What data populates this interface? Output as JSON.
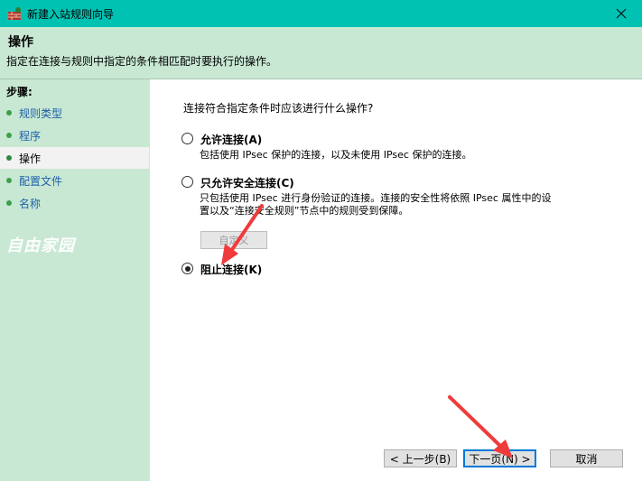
{
  "window": {
    "title": "新建入站规则向导",
    "close_glyph": "✕"
  },
  "header": {
    "title": "操作",
    "subtitle": "指定在连接与规则中指定的条件相匹配时要执行的操作。"
  },
  "nav": {
    "title": "步骤:",
    "items": [
      {
        "label": "规则类型",
        "selected": false
      },
      {
        "label": "程序",
        "selected": false
      },
      {
        "label": "操作",
        "selected": true
      },
      {
        "label": "配置文件",
        "selected": false
      },
      {
        "label": "名称",
        "selected": false
      }
    ],
    "watermark": "自由家园"
  },
  "main": {
    "question": "连接符合指定条件时应该进行什么操作?",
    "options": [
      {
        "label": "允许连接(A)",
        "desc": [
          "包括使用 IPsec 保护的连接，以及未使用 IPsec 保护的连接。"
        ],
        "checked": false
      },
      {
        "label": "只允许安全连接(C)",
        "desc": [
          "只包括使用 IPsec 进行身份验证的连接。连接的安全性将依照 IPsec 属性中的设",
          "置以及“连接安全规则”节点中的规则受到保障。"
        ],
        "checked": false
      },
      {
        "label": "阻止连接(K)",
        "desc": [],
        "checked": true
      }
    ],
    "custom_button": "自定义"
  },
  "buttons": {
    "back": "< 上一步(B)",
    "next": "下一页(N) >",
    "cancel": "取消"
  },
  "colors": {
    "titlebar": "#00c2b3",
    "panel": "#c8e8d4",
    "annotation_arrow": "#ef3b3b"
  }
}
